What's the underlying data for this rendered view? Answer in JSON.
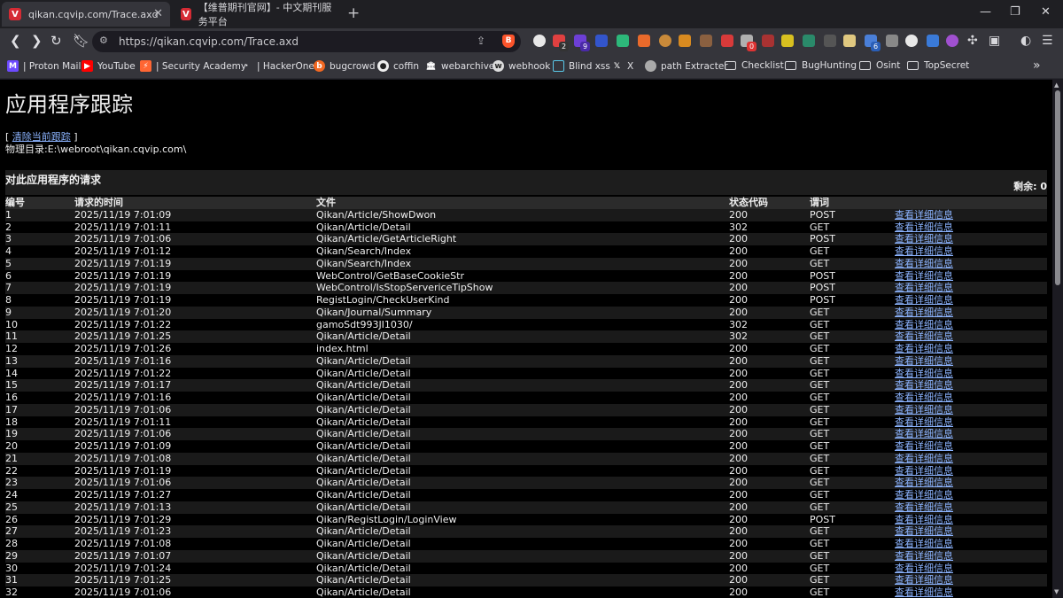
{
  "tabs": [
    {
      "title": "qikan.cqvip.com/Trace.axd",
      "icon": "vip-favicon",
      "active": true
    },
    {
      "title": "【维普期刊官网】- 中文期刊服务平台",
      "icon": "vip-favicon",
      "active": false
    }
  ],
  "toolbar": {
    "url": "https://qikan.cqvip.com/Trace.axd",
    "extension_badges": [
      "2",
      "9",
      "0",
      "6"
    ]
  },
  "bookmarks": [
    {
      "label": "| Proton Mail",
      "icon": "proton-mail-icon",
      "color": "#6d4aff"
    },
    {
      "label": "YouTube",
      "icon": "youtube-icon",
      "color": "#ff0000"
    },
    {
      "label": "| Security Academy",
      "icon": "portswigger-icon",
      "color": "#ff6633"
    },
    {
      "label": "| HackerOne",
      "icon": "hackerone-icon",
      "color": "#35353b"
    },
    {
      "label": "bugcrowd",
      "icon": "bugcrowd-icon",
      "color": "#f26822"
    },
    {
      "label": "coffin",
      "icon": "github-icon",
      "color": "#35353b"
    },
    {
      "label": "webarchive",
      "icon": "archive-icon",
      "color": "#35353b"
    },
    {
      "label": "webhook",
      "icon": "webhook-icon",
      "color": "#35353b"
    },
    {
      "label": "Blind xss",
      "icon": "document-icon",
      "color": "#35353b"
    },
    {
      "label": "X",
      "icon": "x-icon",
      "color": "#35353b"
    },
    {
      "label": "path Extracter",
      "icon": "globe-icon",
      "color": "#35353b"
    },
    {
      "label": "Checklist",
      "icon": "folder-icon",
      "color": ""
    },
    {
      "label": "BugHunting",
      "icon": "folder-icon",
      "color": ""
    },
    {
      "label": "Osint",
      "icon": "folder-icon",
      "color": ""
    },
    {
      "label": "TopSecret",
      "icon": "folder-icon",
      "color": ""
    }
  ],
  "page": {
    "title": "应用程序跟踪",
    "clear_open": "[ ",
    "clear_link": "清除当前跟踪",
    "clear_close": " ]",
    "physical_dir": "物理目录:E:\\webroot\\qikan.cqvip.com\\",
    "section_title": "对此应用程序的请求",
    "remaining": "剩余: 0"
  },
  "table": {
    "headers": [
      "编号",
      "请求的时间",
      "文件",
      "状态代码",
      "谓词",
      ""
    ],
    "detail_label": "查看详细信息",
    "rows": [
      [
        "1",
        "2025/11/19 7:01:09",
        "Qikan/Article/ShowDwon",
        "200",
        "POST"
      ],
      [
        "2",
        "2025/11/19 7:01:11",
        "Qikan/Article/Detail",
        "302",
        "GET"
      ],
      [
        "3",
        "2025/11/19 7:01:06",
        "Qikan/Article/GetArticleRight",
        "200",
        "POST"
      ],
      [
        "4",
        "2025/11/19 7:01:12",
        "Qikan/Search/Index",
        "200",
        "GET"
      ],
      [
        "5",
        "2025/11/19 7:01:19",
        "Qikan/Search/Index",
        "200",
        "GET"
      ],
      [
        "6",
        "2025/11/19 7:01:19",
        "WebControl/GetBaseCookieStr",
        "200",
        "POST"
      ],
      [
        "7",
        "2025/11/19 7:01:19",
        "WebControl/IsStopServericeTipShow",
        "200",
        "POST"
      ],
      [
        "8",
        "2025/11/19 7:01:19",
        "RegistLogin/CheckUserKind",
        "200",
        "POST"
      ],
      [
        "9",
        "2025/11/19 7:01:20",
        "Qikan/Journal/Summary",
        "200",
        "GET"
      ],
      [
        "10",
        "2025/11/19 7:01:22",
        "gamoSdt993JI1030/",
        "302",
        "GET"
      ],
      [
        "11",
        "2025/11/19 7:01:25",
        "Qikan/Article/Detail",
        "302",
        "GET"
      ],
      [
        "12",
        "2025/11/19 7:01:26",
        "index.html",
        "200",
        "GET"
      ],
      [
        "13",
        "2025/11/19 7:01:16",
        "Qikan/Article/Detail",
        "200",
        "GET"
      ],
      [
        "14",
        "2025/11/19 7:01:22",
        "Qikan/Article/Detail",
        "200",
        "GET"
      ],
      [
        "15",
        "2025/11/19 7:01:17",
        "Qikan/Article/Detail",
        "200",
        "GET"
      ],
      [
        "16",
        "2025/11/19 7:01:16",
        "Qikan/Article/Detail",
        "200",
        "GET"
      ],
      [
        "17",
        "2025/11/19 7:01:06",
        "Qikan/Article/Detail",
        "200",
        "GET"
      ],
      [
        "18",
        "2025/11/19 7:01:11",
        "Qikan/Article/Detail",
        "200",
        "GET"
      ],
      [
        "19",
        "2025/11/19 7:01:06",
        "Qikan/Article/Detail",
        "200",
        "GET"
      ],
      [
        "20",
        "2025/11/19 7:01:09",
        "Qikan/Article/Detail",
        "200",
        "GET"
      ],
      [
        "21",
        "2025/11/19 7:01:08",
        "Qikan/Article/Detail",
        "200",
        "GET"
      ],
      [
        "22",
        "2025/11/19 7:01:19",
        "Qikan/Article/Detail",
        "200",
        "GET"
      ],
      [
        "23",
        "2025/11/19 7:01:06",
        "Qikan/Article/Detail",
        "200",
        "GET"
      ],
      [
        "24",
        "2025/11/19 7:01:27",
        "Qikan/Article/Detail",
        "200",
        "GET"
      ],
      [
        "25",
        "2025/11/19 7:01:13",
        "Qikan/Article/Detail",
        "200",
        "GET"
      ],
      [
        "26",
        "2025/11/19 7:01:29",
        "Qikan/RegistLogin/LoginView",
        "200",
        "POST"
      ],
      [
        "27",
        "2025/11/19 7:01:23",
        "Qikan/Article/Detail",
        "200",
        "GET"
      ],
      [
        "28",
        "2025/11/19 7:01:08",
        "Qikan/Article/Detail",
        "200",
        "GET"
      ],
      [
        "29",
        "2025/11/19 7:01:07",
        "Qikan/Article/Detail",
        "200",
        "GET"
      ],
      [
        "30",
        "2025/11/19 7:01:24",
        "Qikan/Article/Detail",
        "200",
        "GET"
      ],
      [
        "31",
        "2025/11/19 7:01:25",
        "Qikan/Article/Detail",
        "200",
        "GET"
      ],
      [
        "32",
        "2025/11/19 7:01:06",
        "Qikan/Article/Detail",
        "200",
        "GET"
      ]
    ]
  }
}
